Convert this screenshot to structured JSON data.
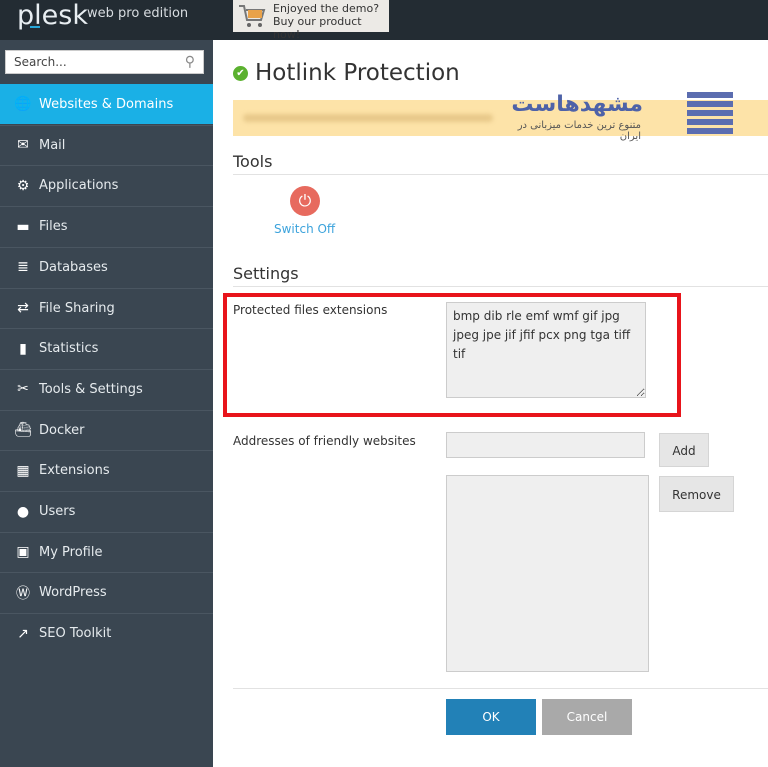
{
  "header": {
    "logo": "plesk",
    "edition": "web pro edition",
    "promo_line1": "Enjoyed the demo?",
    "promo_line2": "Buy our product now!"
  },
  "sidebar": {
    "search_placeholder": "Search...",
    "items": [
      {
        "label": "Websites & Domains",
        "icon": "globe-icon",
        "active": true
      },
      {
        "label": "Mail",
        "icon": "mail-icon"
      },
      {
        "label": "Applications",
        "icon": "gear-icon"
      },
      {
        "label": "Files",
        "icon": "folder-icon"
      },
      {
        "label": "Databases",
        "icon": "database-icon"
      },
      {
        "label": "File Sharing",
        "icon": "file-sharing-icon"
      },
      {
        "label": "Statistics",
        "icon": "bar-chart-icon"
      },
      {
        "label": "Tools & Settings",
        "icon": "tools-icon"
      },
      {
        "label": "Docker",
        "icon": "docker-icon"
      },
      {
        "label": "Extensions",
        "icon": "extensions-icon"
      },
      {
        "label": "Users",
        "icon": "user-icon"
      },
      {
        "label": "My Profile",
        "icon": "profile-icon"
      },
      {
        "label": "WordPress",
        "icon": "wordpress-icon"
      },
      {
        "label": "SEO Toolkit",
        "icon": "seo-icon"
      }
    ]
  },
  "main": {
    "title": "Hotlink Protection",
    "watermark": {
      "name": "مشهدهاست",
      "tagline": "متنوع ترین خدمات میزبانی در ایران"
    },
    "tools_heading": "Tools",
    "switch_off": "Switch Off",
    "settings_heading": "Settings",
    "protected_label": "Protected files extensions",
    "protected_value": "bmp dib rle emf wmf gif jpg jpeg jpe jif jfif pcx png tga tiff tif",
    "friendly_label": "Addresses of friendly websites",
    "friendly_input": "",
    "add": "Add",
    "remove": "Remove",
    "ok": "OK",
    "cancel": "Cancel"
  },
  "colors": {
    "accent": "#1ab0e6",
    "highlight": "#e8141b",
    "ok_button": "#2281b7"
  }
}
